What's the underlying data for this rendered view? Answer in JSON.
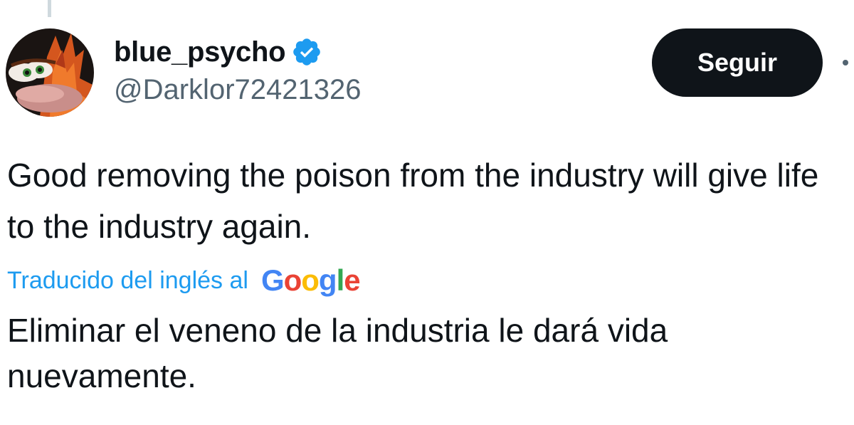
{
  "tweet": {
    "author": {
      "display_name": "blue_psycho",
      "handle": "@Darklor72421326",
      "verified_icon": "verified-badge-icon",
      "avatar_icon": "avatar-image"
    },
    "follow_label": "Seguir",
    "more_icon": "more-options-icon",
    "text": "Good removing the poison from the industry will give life to the industry again.",
    "translation": {
      "label": "Traducido del inglés al",
      "provider": "Google",
      "text": "Eliminar el veneno de la industria le dará vida nuevamente."
    }
  },
  "colors": {
    "text_primary": "#0f1419",
    "text_secondary": "#536471",
    "accent": "#1d9bf0",
    "button_bg": "#0f1419",
    "button_text": "#ffffff"
  }
}
